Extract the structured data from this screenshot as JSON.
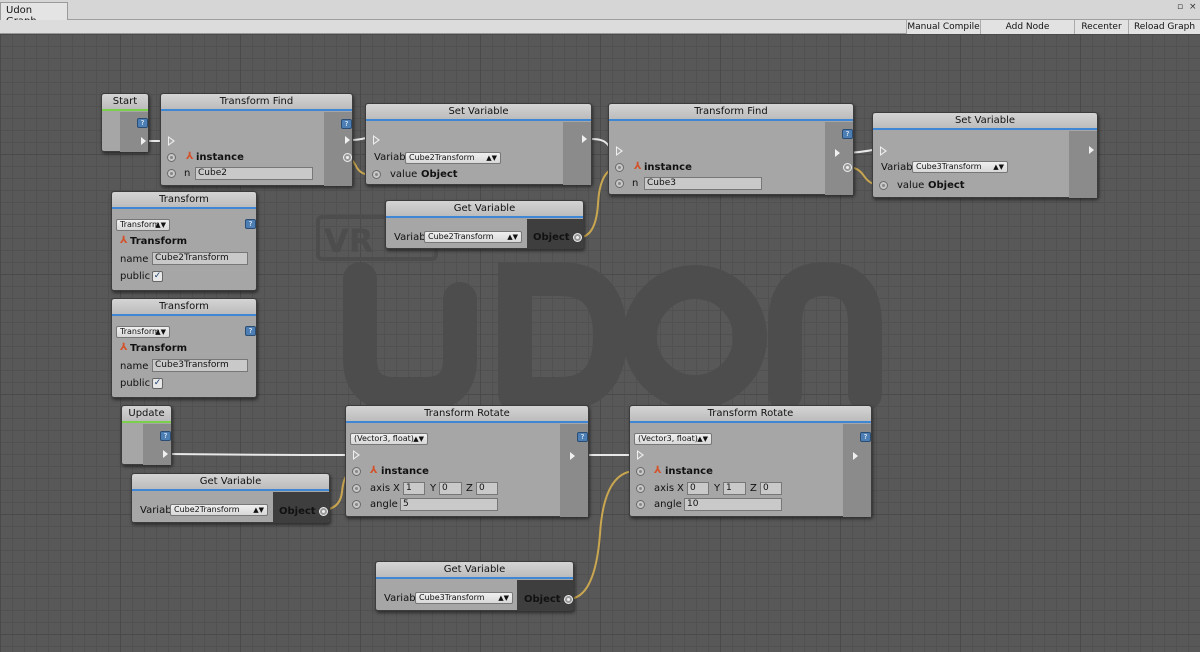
{
  "window": {
    "tab_title": "Udon Graph",
    "controls": [
      "▫",
      "×"
    ]
  },
  "toolbar": {
    "manual_compile": "Manual Compile",
    "add_node": "Add Node",
    "recenter": "Recenter",
    "reload_graph": "Reload Graph"
  },
  "watermark": {
    "vr_text": "VR",
    "udon_text": "UDON"
  },
  "nodes": {
    "start": {
      "title": "Start"
    },
    "update": {
      "title": "Update"
    },
    "transform_find_1": {
      "title": "Transform Find",
      "instance": "instance",
      "n_label": "n",
      "n_value": "Cube2"
    },
    "set_variable_1": {
      "title": "Set Variable",
      "var_label": "Variab",
      "var_value": "Cube2Transform",
      "value_label": "value",
      "value_type": "Object"
    },
    "transform_find_2": {
      "title": "Transform Find",
      "instance": "instance",
      "n_label": "n",
      "n_value": "Cube3"
    },
    "set_variable_2": {
      "title": "Set Variable",
      "var_label": "Variab",
      "var_value": "Cube3Transform",
      "value_label": "value",
      "value_type": "Object"
    },
    "get_variable_1": {
      "title": "Get Variable",
      "var_label": "Variab",
      "var_value": "Cube2Transform",
      "out_type": "Object"
    },
    "transform_var_1": {
      "title": "Transform",
      "type_dropdown": "Transform",
      "type_label": "Transform",
      "name_label": "name",
      "name_value": "Cube2Transform",
      "public_label": "public",
      "public_checked": "✓"
    },
    "transform_var_2": {
      "title": "Transform",
      "type_dropdown": "Transform",
      "type_label": "Transform",
      "name_label": "name",
      "name_value": "Cube3Transform",
      "public_label": "public",
      "public_checked": "✓"
    },
    "transform_rotate_1": {
      "title": "Transform Rotate",
      "overload": "(Vector3, float)",
      "instance": "instance",
      "axis_label": "axis",
      "x_label": "X",
      "x_value": "1",
      "y_label": "Y",
      "y_value": "0",
      "z_label": "Z",
      "z_value": "0",
      "angle_label": "angle",
      "angle_value": "5"
    },
    "transform_rotate_2": {
      "title": "Transform Rotate",
      "overload": "(Vector3, float)",
      "instance": "instance",
      "axis_label": "axis",
      "x_label": "X",
      "x_value": "0",
      "y_label": "Y",
      "y_value": "1",
      "z_label": "Z",
      "z_value": "0",
      "angle_label": "angle",
      "angle_value": "10"
    },
    "get_variable_2": {
      "title": "Get Variable",
      "var_label": "Variab",
      "var_value": "Cube2Transform",
      "out_type": "Object"
    },
    "get_variable_3": {
      "title": "Get Variable",
      "var_label": "Variab",
      "var_value": "Cube3Transform",
      "out_type": "Object"
    }
  },
  "colors": {
    "flow_wire": "#e8e8e8",
    "data_wire": "#c9a650",
    "accent": "#3f86d4",
    "event_accent": "#7ad04a"
  }
}
